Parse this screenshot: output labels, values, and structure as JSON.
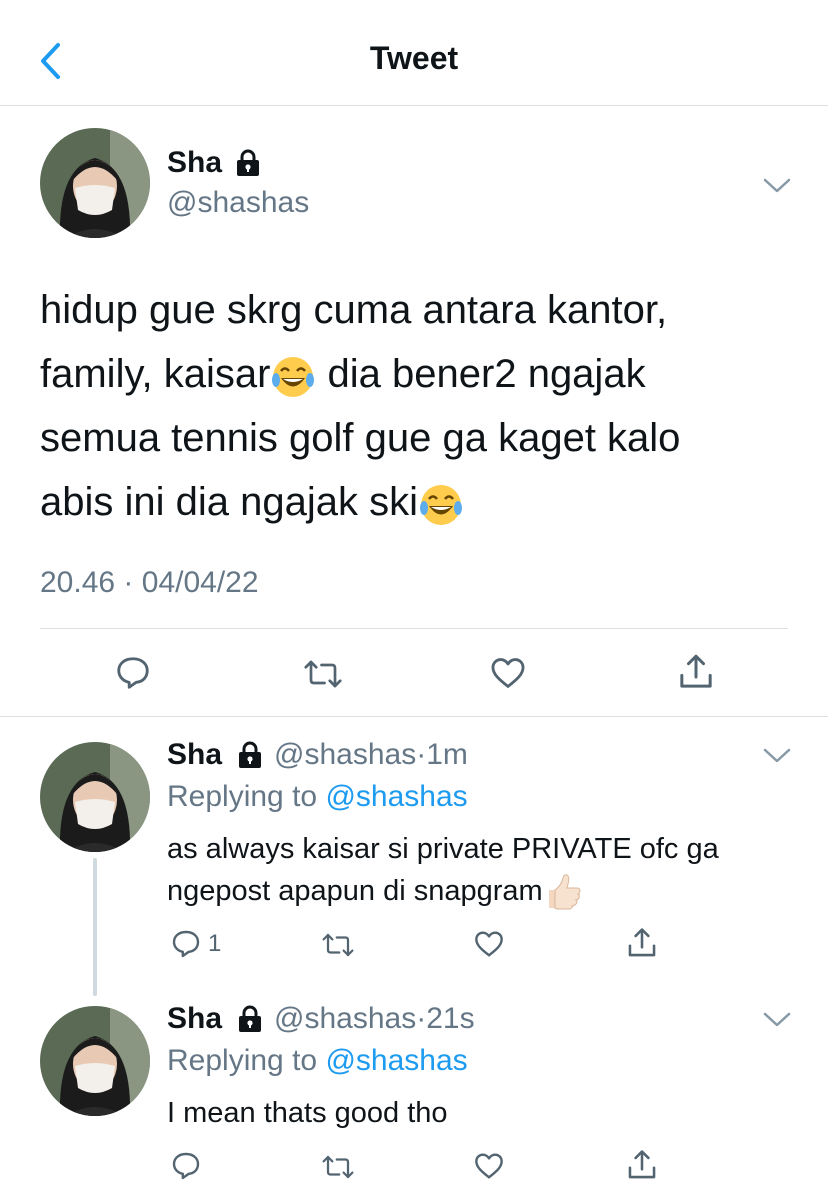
{
  "header": {
    "title": "Tweet",
    "back_icon": "chevron-left-icon"
  },
  "colors": {
    "accent": "#1d9bf0",
    "muted": "#657786",
    "text": "#0f1419",
    "divider": "#dcdfe3"
  },
  "main_tweet": {
    "name": "Sha",
    "handle": "@shashas",
    "text_lines": [
      "hidup gue skrg cuma antara kantor,",
      "family, kaisar",
      " dia bener2 ngajak",
      "semua tennis golf gue ga kaget kalo",
      "abis ini dia ngajak ski"
    ],
    "time": "20.46",
    "date": "04/04/22",
    "separator": "·",
    "emoji": "face-with-tears-of-joy"
  },
  "replies": [
    {
      "name": "Sha",
      "handle": "@shashas",
      "time": "1m",
      "replying_label": "Replying to",
      "replying_handle": "@shashas",
      "text_line1": "as always kaisar si private PRIVATE ofc ga",
      "text_line2": "ngepost apapun di snapgram",
      "reply_count": "1",
      "emoji": "thumbs-up"
    },
    {
      "name": "Sha",
      "handle": "@shashas",
      "time": "21s",
      "replying_label": "Replying to",
      "replying_handle": "@shashas",
      "text_line1": "I mean thats good tho",
      "reply_count": ""
    }
  ]
}
